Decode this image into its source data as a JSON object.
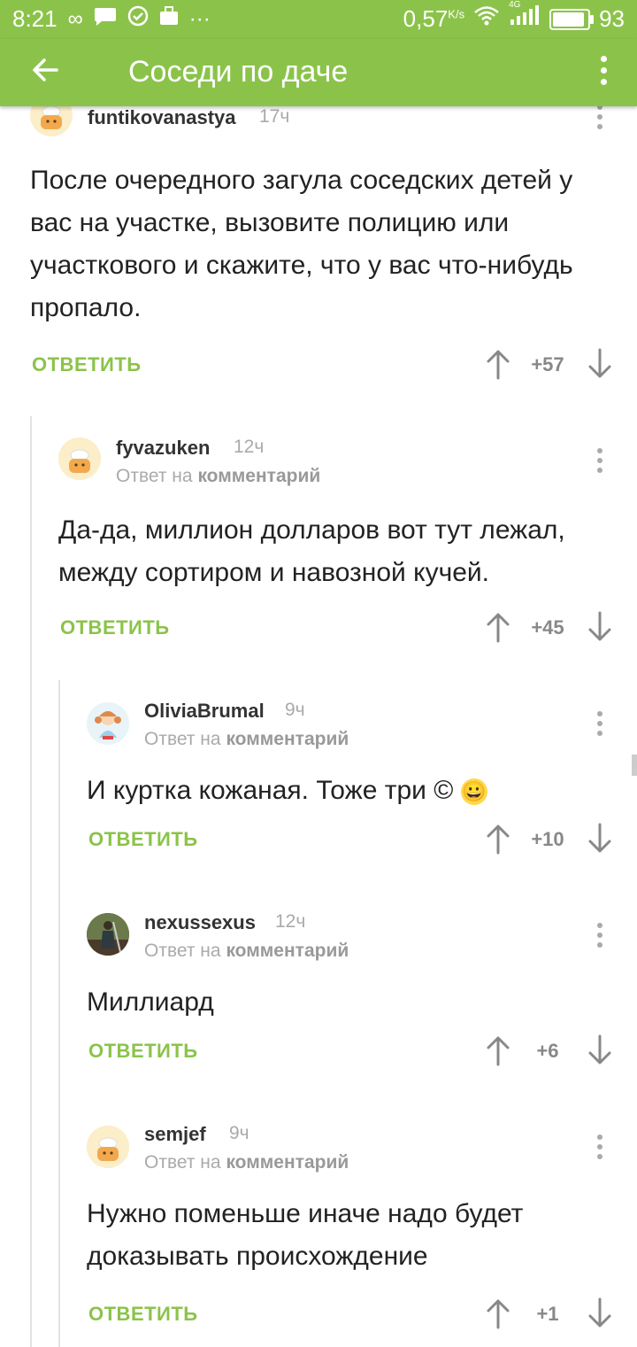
{
  "status_bar": {
    "time": "8:21",
    "left_icons": [
      "infinity-icon",
      "message-icon",
      "check-circle-icon",
      "briefcase-icon",
      "more-icon"
    ],
    "speed": "0,57",
    "speed_unit": "K/s",
    "network": "4G",
    "battery": "93",
    "battery_level": 0.93
  },
  "app_bar": {
    "title": "Соседи по даче"
  },
  "comments": [
    {
      "username": "funtikovanastya",
      "time": "17ч",
      "reply_to_prefix": "",
      "reply_to_link": "",
      "text": "После очередного загула соседских детей у вас на участке, вызовите полицию или участкового и скажите, что у вас что-нибудь пропало.",
      "reply_label": "ОТВЕТИТЬ",
      "score": "+57"
    },
    {
      "username": "fyvazuken",
      "time": "12ч",
      "reply_to_prefix": "Ответ на",
      "reply_to_link": "комментарий",
      "text": "Да-да, миллион долларов вот тут лежал, между сортиром и навозной кучей.",
      "reply_label": "ОТВЕТИТЬ",
      "score": "+45"
    },
    {
      "username": "OliviaBrumal",
      "time": "9ч",
      "reply_to_prefix": "Ответ на",
      "reply_to_link": "комментарий",
      "text": "И куртка кожаная. Тоже три ©",
      "emoji": "😀",
      "reply_label": "ОТВЕТИТЬ",
      "score": "+10"
    },
    {
      "username": "nexussexus",
      "time": "12ч",
      "reply_to_prefix": "Ответ на",
      "reply_to_link": "комментарий",
      "text": "Миллиард",
      "reply_label": "ОТВЕТИТЬ",
      "score": "+6"
    },
    {
      "username": "semjef",
      "time": "9ч",
      "reply_to_prefix": "Ответ на",
      "reply_to_link": "комментарий",
      "text": "Нужно поменьше иначе надо будет доказывать происхождение",
      "reply_label": "ОТВЕТИТЬ",
      "score": "+1"
    }
  ]
}
